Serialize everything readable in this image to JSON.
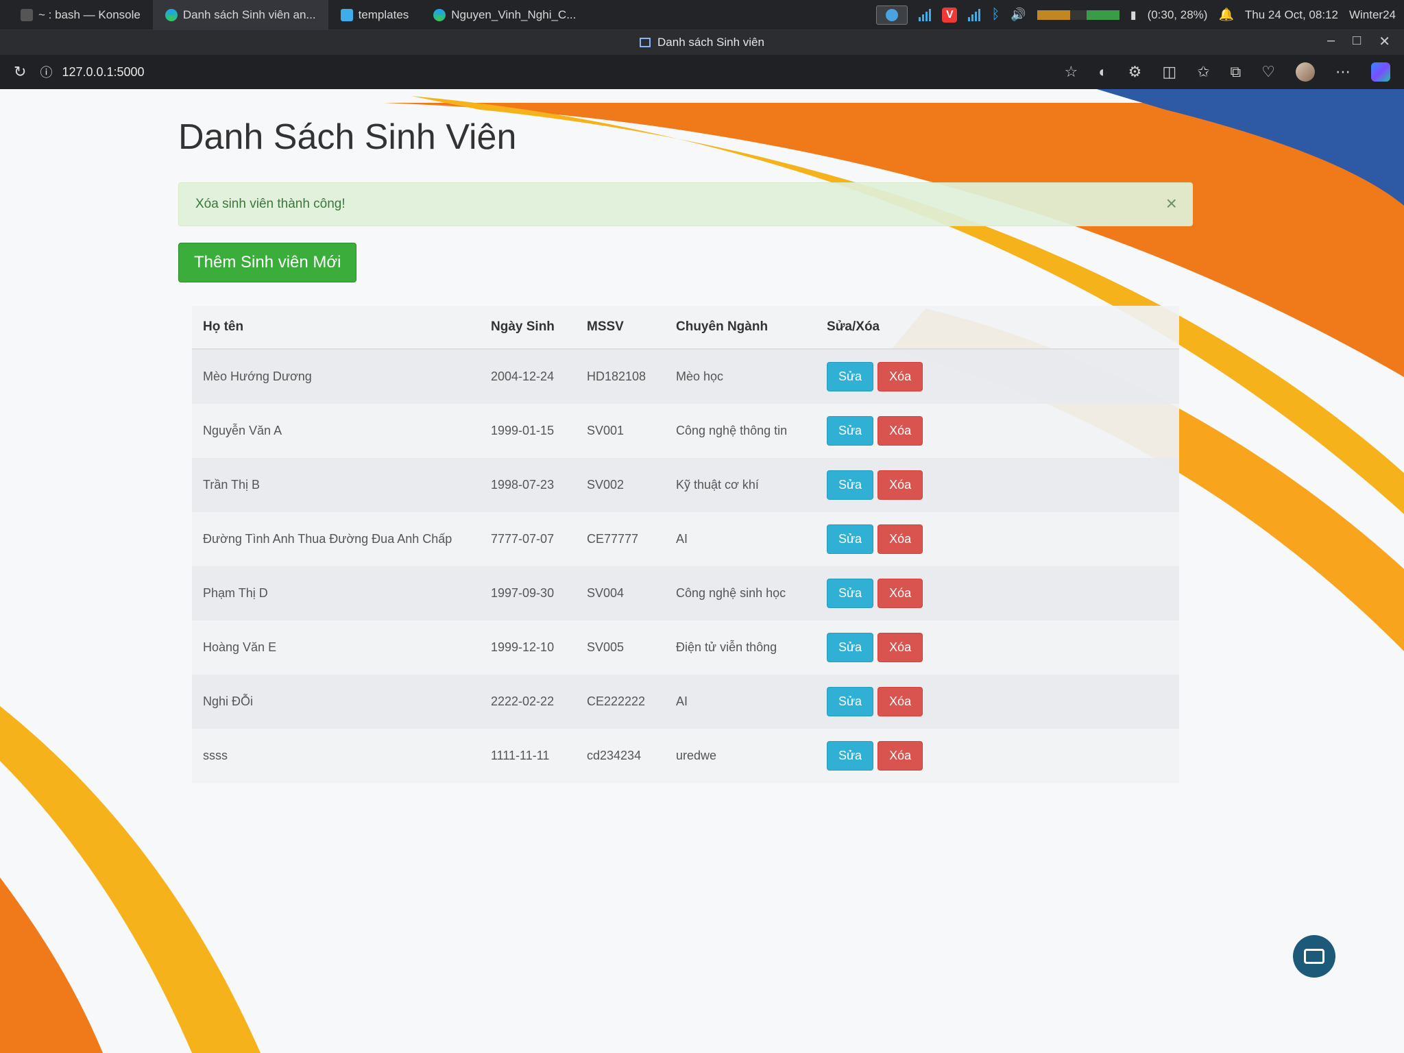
{
  "taskbar": {
    "tasks": [
      "~ : bash — Konsole",
      "Danh sách Sinh viên an...",
      "templates",
      "Nguyen_Vinh_Nghi_C..."
    ],
    "battery": "(0:30, 28%)",
    "clock": "Thu 24 Oct, 08:12",
    "activity": "Winter24"
  },
  "browser": {
    "window_title": "Danh sách Sinh viên",
    "url": "127.0.0.1:5000"
  },
  "page": {
    "title": "Danh Sách Sinh Viên",
    "alert": "Xóa sinh viên thành công!",
    "add_button": "Thêm Sinh viên Mới",
    "columns": [
      "Họ tên",
      "Ngày Sinh",
      "MSSV",
      "Chuyên Ngành",
      "Sửa/Xóa"
    ],
    "edit_label": "Sửa",
    "delete_label": "Xóa",
    "rows": [
      {
        "name": "Mèo Hướng Dương",
        "dob": "2004-12-24",
        "mssv": "HD182108",
        "major": "Mèo học"
      },
      {
        "name": "Nguyễn Văn A",
        "dob": "1999-01-15",
        "mssv": "SV001",
        "major": "Công nghệ thông tin"
      },
      {
        "name": "Trần Thị B",
        "dob": "1998-07-23",
        "mssv": "SV002",
        "major": "Kỹ thuật cơ khí"
      },
      {
        "name": "Đường Tình Anh Thua Đường Đua Anh Chấp",
        "dob": "7777-07-07",
        "mssv": "CE77777",
        "major": "AI"
      },
      {
        "name": "Phạm Thị D",
        "dob": "1997-09-30",
        "mssv": "SV004",
        "major": "Công nghệ sinh học"
      },
      {
        "name": "Hoàng Văn E",
        "dob": "1999-12-10",
        "mssv": "SV005",
        "major": "Điện tử viễn thông"
      },
      {
        "name": "Nghi ĐỖi",
        "dob": "2222-02-22",
        "mssv": "CE222222",
        "major": "AI"
      },
      {
        "name": "ssss",
        "dob": "1111-11-11",
        "mssv": "cd234234",
        "major": "uredwe"
      }
    ]
  },
  "colors": {
    "accent_green": "#3bad3b",
    "edit_blue": "#31b0d5",
    "delete_red": "#d9534f",
    "alert_bg": "#dff0d8"
  }
}
